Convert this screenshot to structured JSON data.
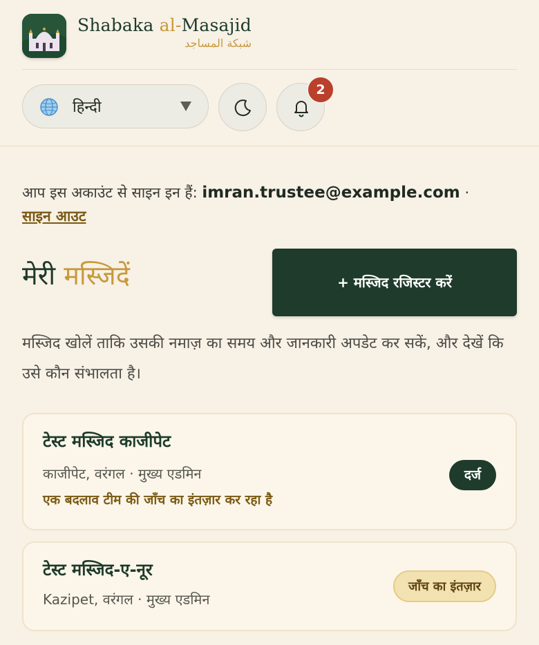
{
  "brand": {
    "name_prefix": "Shabaka ",
    "name_accent": "al-",
    "name_suffix": "Masajid",
    "arabic": "شبكة المساجد"
  },
  "controls": {
    "language_value": "हिन्दी",
    "notification_count": "2"
  },
  "signin": {
    "prefix": "आप इस अकाउंट से साइन इन हैं:",
    "email": "imran.trustee@example.com",
    "separator": "·",
    "signout_label": "साइन आउट"
  },
  "page": {
    "title_part1": "मेरी",
    "title_part2": "मस्जिदें",
    "register_label": "+ मस्जिद रजिस्टर करें",
    "description": "मस्जिद खोलें ताकि उसकी नमाज़ का समय और जानकारी अपडेट कर सकें, और देखें कि उसे कौन संभालता है।"
  },
  "mosques": [
    {
      "name": "टेस्ट मस्जिद काजीपेट",
      "meta": "काजीपेट, वरंगल · मुख्य एडमिन",
      "note": "एक बदलाव टीम की जाँच का इंतज़ार कर रहा है",
      "status": "दर्ज"
    },
    {
      "name": "टेस्ट मस्जिद-ए-नूर",
      "meta": "Kazipet, वरंगल · मुख्य एडमिन",
      "status": "जाँच का इंतज़ार"
    }
  ],
  "colors": {
    "primary": "#1e3b2b",
    "accent": "#c8993b",
    "background": "#f7f1e6",
    "badge": "#b9402b"
  },
  "icons": {
    "logo": "mosque-logo-icon",
    "language": "globe-icon",
    "dropdown": "caret-down-icon",
    "theme": "moon-icon",
    "notifications": "bell-icon"
  }
}
